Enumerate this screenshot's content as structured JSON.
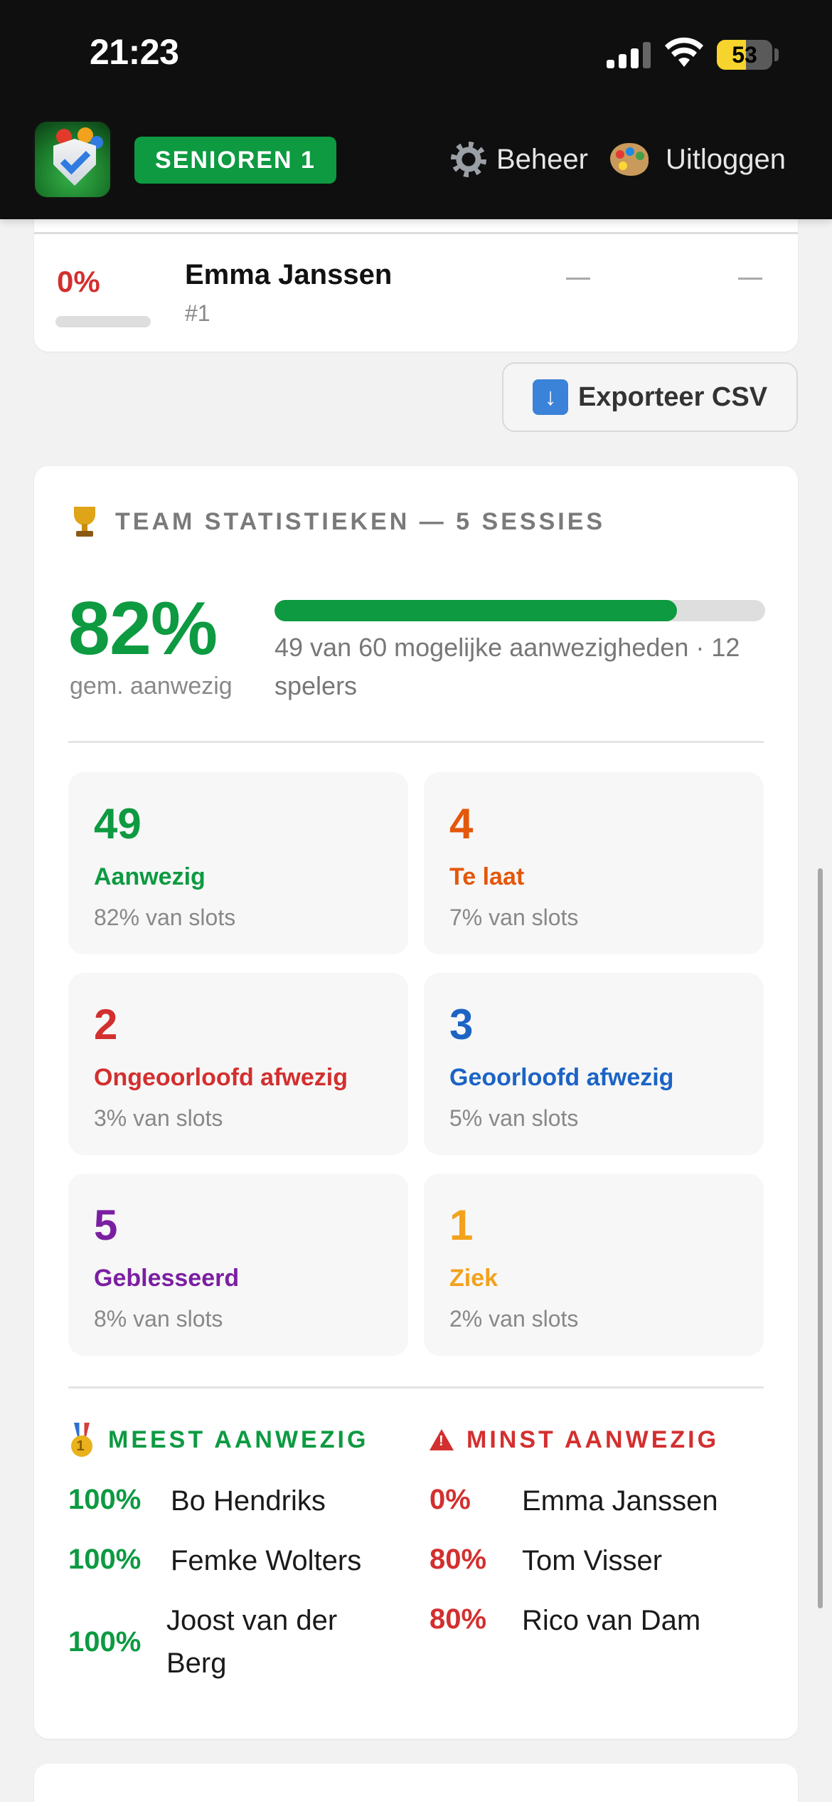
{
  "status_bar": {
    "time": "21:23",
    "battery": "53"
  },
  "header": {
    "team": "SENIOREN 1",
    "beheer": "Beheer",
    "uitloggen": "Uitloggen"
  },
  "previous_row": {
    "percent": "0%",
    "name": "Emma Janssen",
    "rank": "#1",
    "dash_1": "—",
    "dash_2": "—"
  },
  "export": {
    "label": "Exporteer CSV"
  },
  "stats": {
    "title": "TEAM STATISTIEKEN — 5 SESSIES",
    "avg_percent": "82%",
    "avg_label": "gem. aanwezig",
    "avg_fraction": 0.82,
    "summary_text": "49 van 60 mogelijke aanwezigheden · 12 spelers",
    "tiles": [
      {
        "value": "49",
        "label": "Aanwezig",
        "sub": "82% van slots",
        "color": "#0d9a41"
      },
      {
        "value": "4",
        "label": "Te laat",
        "sub": "7% van slots",
        "color": "#e4570c"
      },
      {
        "value": "2",
        "label": "Ongeoorloofd afwezig",
        "sub": "3% van slots",
        "color": "#d32f2f"
      },
      {
        "value": "3",
        "label": "Geoorloofd afwezig",
        "sub": "5% van slots",
        "color": "#1c64c4"
      },
      {
        "value": "5",
        "label": "Geblesseerd",
        "sub": "8% van slots",
        "color": "#7b1fa2"
      },
      {
        "value": "1",
        "label": "Ziek",
        "sub": "2% van slots",
        "color": "#f2a21c"
      }
    ],
    "most_title": "MEEST AANWEZIG",
    "least_title": "MINST AANWEZIG",
    "most": [
      {
        "pct": "100%",
        "name": "Bo Hendriks"
      },
      {
        "pct": "100%",
        "name": "Femke Wolters"
      },
      {
        "pct": "100%",
        "name": "Joost van der Berg"
      }
    ],
    "least": [
      {
        "pct": "0%",
        "name": "Emma Janssen"
      },
      {
        "pct": "80%",
        "name": "Tom Visser"
      },
      {
        "pct": "80%",
        "name": "Rico van Dam"
      }
    ]
  },
  "colors": {
    "green": "#0d9a41",
    "red": "#d32f2f",
    "header_bg": "#0f0f0f"
  }
}
